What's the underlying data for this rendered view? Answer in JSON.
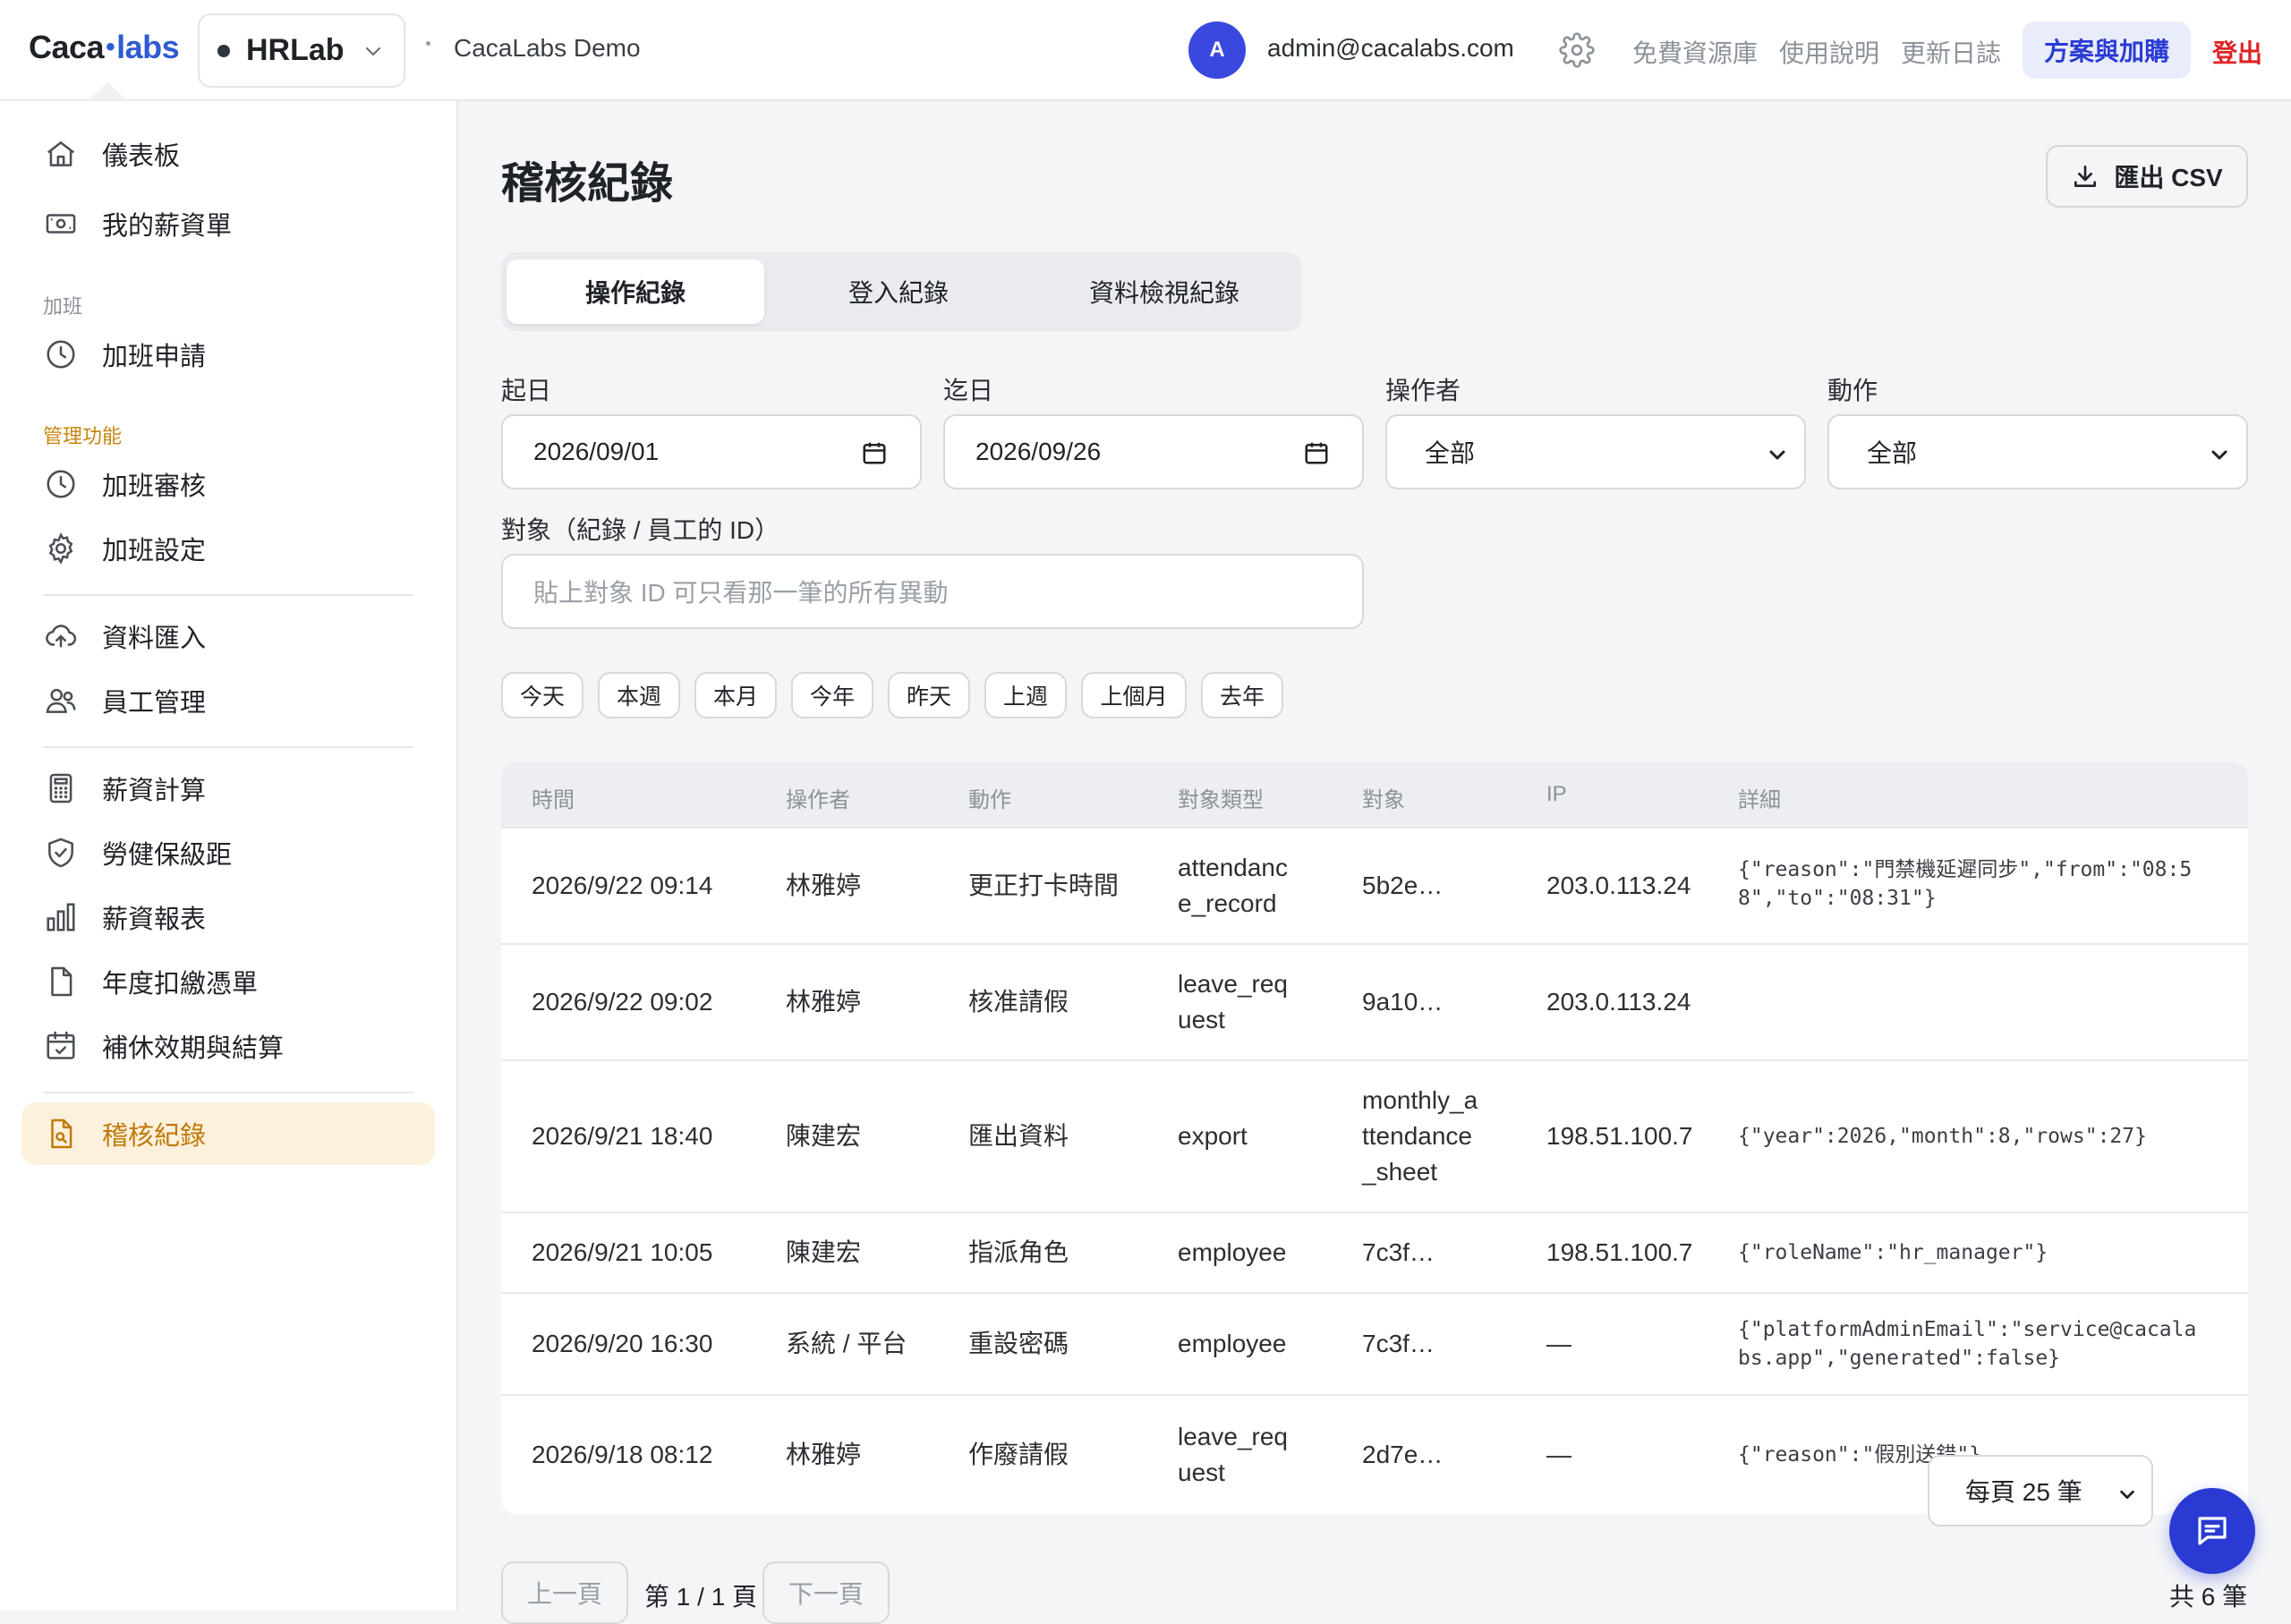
{
  "header": {
    "logo_part1": "Caca",
    "logo_part2": "labs",
    "org_name": "HRLab",
    "workspace": "CacaLabs Demo",
    "avatar_initial": "A",
    "email": "admin@cacalabs.com",
    "links": [
      "免費資源庫",
      "使用說明",
      "更新日誌"
    ],
    "plan_button": "方案與加購",
    "logout": "登出",
    "accent_color": "#2a3bd3"
  },
  "sidebar": {
    "items": [
      {
        "label": "儀表板",
        "icon": "home-icon"
      },
      {
        "label": "我的薪資單",
        "icon": "payslip-icon"
      },
      {
        "label": "加班申請",
        "icon": "clock-icon"
      },
      {
        "label": "加班審核",
        "icon": "clock-icon"
      },
      {
        "label": "加班設定",
        "icon": "gear-icon"
      },
      {
        "label": "資料匯入",
        "icon": "cloud-upload-icon"
      },
      {
        "label": "員工管理",
        "icon": "users-icon"
      },
      {
        "label": "薪資計算",
        "icon": "calculator-icon"
      },
      {
        "label": "勞健保級距",
        "icon": "shield-check-icon"
      },
      {
        "label": "薪資報表",
        "icon": "bar-chart-icon"
      },
      {
        "label": "年度扣繳憑單",
        "icon": "document-icon"
      },
      {
        "label": "補休效期與結算",
        "icon": "calendar-check-icon"
      },
      {
        "label": "稽核紀錄",
        "icon": "audit-file-icon"
      }
    ],
    "sections": {
      "overtime": "加班",
      "admin": "管理功能"
    },
    "active_color": "#c07a09"
  },
  "main": {
    "title": "稽核紀錄",
    "export_label": "匯出 CSV",
    "tabs": [
      "操作紀錄",
      "登入紀錄",
      "資料檢視紀錄"
    ],
    "active_tab": "操作紀錄",
    "filters": {
      "from_label": "起日",
      "from_value": "2026/09/01",
      "to_label": "迄日",
      "to_value": "2026/09/26",
      "operator_label": "操作者",
      "operator_value": "全部",
      "action_label": "動作",
      "action_value": "全部",
      "target_label": "對象（紀錄 / 員工的 ID）",
      "target_placeholder": "貼上對象 ID 可只看那一筆的所有異動"
    },
    "quick_ranges": [
      "今天",
      "本週",
      "本月",
      "今年",
      "昨天",
      "上週",
      "上個月",
      "去年"
    ],
    "table": {
      "headers": [
        "時間",
        "操作者",
        "動作",
        "對象類型",
        "對象",
        "IP",
        "詳細"
      ],
      "rows": [
        {
          "time": "2026/9/22 09:14",
          "operator": "林雅婷",
          "action": "更正打卡時間",
          "type1": "attendanc",
          "type2": "e_record",
          "target1": "5b2e…",
          "ip": "203.0.113.24",
          "detail1": "{\"reason\":\"門禁機延遲同步\",\"from\":\"08:5",
          "detail2": "8\",\"to\":\"08:31\"}"
        },
        {
          "time": "2026/9/22 09:02",
          "operator": "林雅婷",
          "action": "核准請假",
          "type1": "leave_req",
          "type2": "uest",
          "target1": "9a10…",
          "ip": "203.0.113.24"
        },
        {
          "time": "2026/9/21 18:40",
          "operator": "陳建宏",
          "action": "匯出資料",
          "type1": "export",
          "target1": "monthly_a",
          "target2": "ttendance",
          "target3": "_sheet",
          "ip": "198.51.100.7",
          "detail1": "{\"year\":2026,\"month\":8,\"rows\":27}"
        },
        {
          "time": "2026/9/21 10:05",
          "operator": "陳建宏",
          "action": "指派角色",
          "type1": "employee",
          "target1": "7c3f…",
          "ip": "198.51.100.7",
          "detail1": "{\"roleName\":\"hr_manager\"}"
        },
        {
          "time": "2026/9/20 16:30",
          "operator": "系統 / 平台",
          "action": "重設密碼",
          "type1": "employee",
          "target1": "7c3f…",
          "ip": "—",
          "detail1": "{\"platformAdminEmail\":\"service@cacala",
          "detail2": "bs.app\",\"generated\":false}"
        },
        {
          "time": "2026/9/18 08:12",
          "operator": "林雅婷",
          "action": "作廢請假",
          "type1": "leave_req",
          "type2": "uest",
          "target1": "2d7e…",
          "ip": "—",
          "detail1": "{\"reason\":\"假別送錯\"}"
        }
      ]
    },
    "pager": {
      "prev": "上一頁",
      "page": "第 1 / 1 頁",
      "next": "下一頁",
      "per_page": "每頁 25 筆",
      "total": "共 6 筆"
    }
  }
}
